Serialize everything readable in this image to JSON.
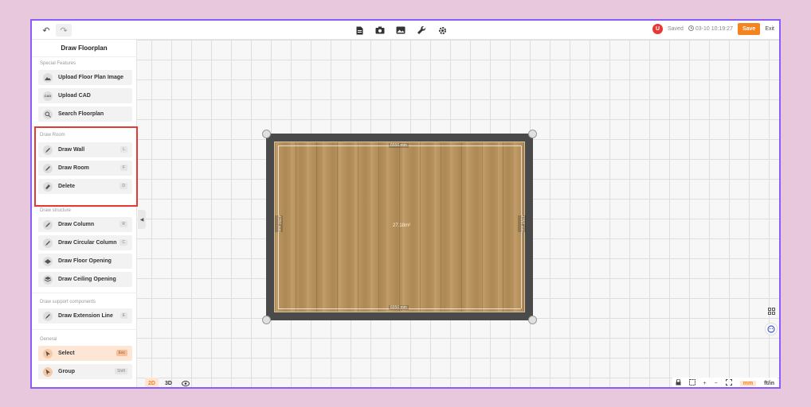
{
  "toolbar": {
    "undo": "↶",
    "redo": "↷",
    "user_initial": "U",
    "saved_text": "Saved",
    "saved_time": "03-10 10:19:27",
    "save_label": "Save",
    "exit_label": "Exit"
  },
  "sidebar": {
    "title": "Draw Floorplan",
    "sections": {
      "special": "Special Features",
      "draw_room": "Draw Room",
      "structure": "Draw structure",
      "support": "Draw support components",
      "general": "General"
    },
    "items": {
      "upload_floor": "Upload Floor Plan Image",
      "upload_cad": "Upload CAD",
      "search_floor": "Search Floorplan",
      "draw_wall": "Draw Wall",
      "draw_wall_key": "L",
      "draw_room": "Draw Room",
      "draw_room_key": "F",
      "delete": "Delete",
      "delete_key": "D",
      "draw_column": "Draw Column",
      "draw_column_key": "R",
      "draw_circ_column": "Draw Circular Column",
      "draw_circ_column_key": "C",
      "draw_floor_opening": "Draw Floor Opening",
      "draw_ceiling_opening": "Draw Ceiling Opening",
      "draw_ext_line": "Draw Extension Line",
      "draw_ext_line_key": "E",
      "select": "Select",
      "select_key": "Esc",
      "group": "Group",
      "group_key": "Shift"
    }
  },
  "room": {
    "top_dim": "6550 mm",
    "bottom_dim": "6550 mm",
    "left_dim": "4150 mm",
    "right_dim": "4150 mm",
    "area": "27.18m²"
  },
  "view": {
    "mode_2d": "2D",
    "mode_3d": "3D",
    "unit_mm": "mm",
    "unit_ftin": "ft/in",
    "plus": "+",
    "minus": "−"
  }
}
